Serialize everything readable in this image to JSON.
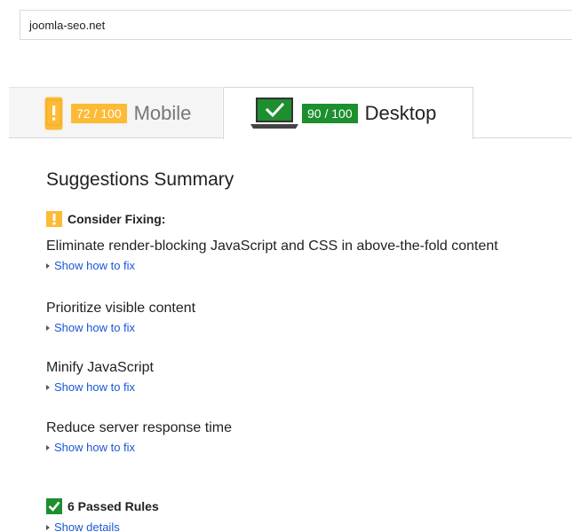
{
  "url_input": {
    "value": "joomla-seo.net"
  },
  "tabs": [
    {
      "score": "72 / 100",
      "label": "Mobile",
      "icon": "phone-icon",
      "color": "#fdba35",
      "active": false
    },
    {
      "score": "90 / 100",
      "label": "Desktop",
      "icon": "laptop-icon",
      "color": "#1d8f2e",
      "active": true
    }
  ],
  "summary": {
    "title": "Suggestions Summary",
    "consider_fixing": {
      "label": "Consider Fixing:",
      "icon": "warning-icon",
      "rules": [
        {
          "title": "Eliminate render-blocking JavaScript and CSS in above-the-fold content",
          "link": "Show how to fix"
        },
        {
          "title": "Prioritize visible content",
          "link": "Show how to fix"
        },
        {
          "title": "Minify JavaScript",
          "link": "Show how to fix"
        },
        {
          "title": "Reduce server response time",
          "link": "Show how to fix"
        }
      ]
    },
    "passed": {
      "label": "6 Passed Rules",
      "icon": "checkmark-icon",
      "link": "Show details"
    }
  },
  "colors": {
    "link": "#1a57d6",
    "warning": "#fdba35",
    "pass": "#1d8f2e"
  }
}
